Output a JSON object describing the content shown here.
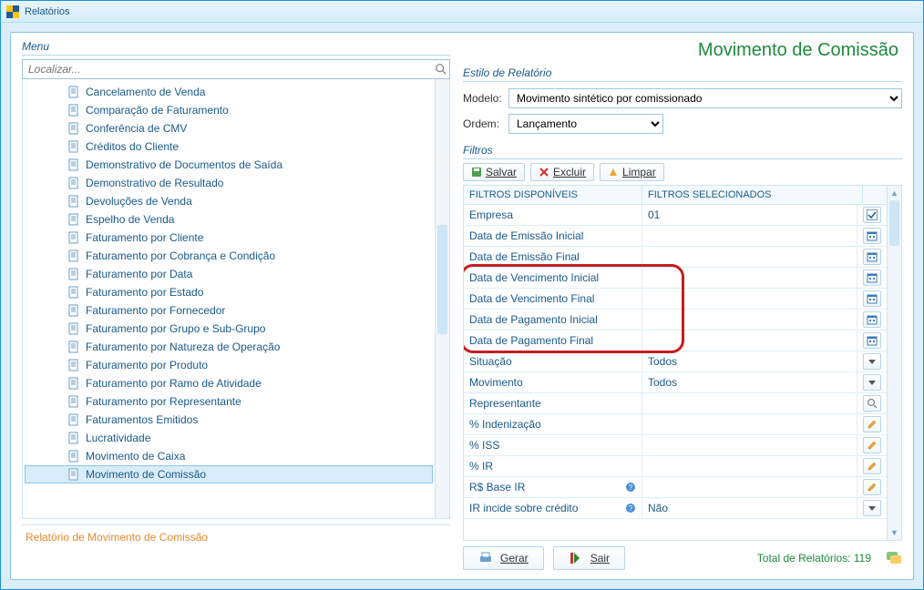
{
  "window": {
    "title": "Relatórios"
  },
  "menu": {
    "label": "Menu",
    "search_placeholder": "Localizar...",
    "items": [
      {
        "label": "Cancelamento de Venda"
      },
      {
        "label": "Comparação de Faturamento"
      },
      {
        "label": "Conferência de CMV"
      },
      {
        "label": "Créditos do Cliente"
      },
      {
        "label": "Demonstrativo de Documentos de Saída"
      },
      {
        "label": "Demonstrativo de Resultado"
      },
      {
        "label": "Devoluções de Venda"
      },
      {
        "label": "Espelho de Venda"
      },
      {
        "label": "Faturamento por Cliente"
      },
      {
        "label": "Faturamento por Cobrança e Condição"
      },
      {
        "label": "Faturamento por Data"
      },
      {
        "label": "Faturamento por Estado"
      },
      {
        "label": "Faturamento por Fornecedor"
      },
      {
        "label": "Faturamento por Grupo e Sub-Grupo"
      },
      {
        "label": "Faturamento por Natureza de Operação"
      },
      {
        "label": "Faturamento por Produto"
      },
      {
        "label": "Faturamento por Ramo de Atividade"
      },
      {
        "label": "Faturamento por Representante"
      },
      {
        "label": "Faturamentos Emitidos"
      },
      {
        "label": "Lucratividade"
      },
      {
        "label": "Movimento de Caixa"
      },
      {
        "label": "Movimento de Comissão"
      }
    ],
    "selected": "Movimento de Comissão",
    "description": "Relatório de Movimento de Comissão"
  },
  "right": {
    "title": "Movimento de Comissão",
    "style_group": "Estilo de Relatório",
    "modelo_label": "Modelo:",
    "modelo_value": "Movimento sintético por comissionado",
    "ordem_label": "Ordem:",
    "ordem_value": "Lançamento",
    "filters_group": "Filtros",
    "toolbar": {
      "salvar": "Salvar",
      "excluir": "Excluir",
      "limpar": "Limpar"
    },
    "header": {
      "available": "FILTROS DISPONÍVEIS",
      "selected": "FILTROS SELECIONADOS"
    },
    "rows": [
      {
        "label": "Empresa",
        "value": "01",
        "control": "check-select"
      },
      {
        "label": "Data de Emissão Inicial",
        "value": "",
        "control": "calendar"
      },
      {
        "label": "Data de Emissão Final",
        "value": "",
        "control": "calendar"
      },
      {
        "label": "Data de Vencimento Inicial",
        "value": "",
        "control": "calendar"
      },
      {
        "label": "Data de Vencimento Final",
        "value": "",
        "control": "calendar"
      },
      {
        "label": "Data de Pagamento Inicial",
        "value": "",
        "control": "calendar"
      },
      {
        "label": "Data de Pagamento Final",
        "value": "",
        "control": "calendar"
      },
      {
        "label": "Situação",
        "value": "Todos",
        "control": "dropdown"
      },
      {
        "label": "Movimento",
        "value": "Todos",
        "control": "dropdown"
      },
      {
        "label": "Representante",
        "value": "",
        "control": "search"
      },
      {
        "label": "% Indenização",
        "value": "",
        "control": "edit"
      },
      {
        "label": "% ISS",
        "value": "",
        "control": "edit"
      },
      {
        "label": "% IR",
        "value": "",
        "control": "edit"
      },
      {
        "label": "R$ Base IR",
        "value": "",
        "control": "edit",
        "info": true
      },
      {
        "label": "IR incide sobre crédito",
        "value": "Não",
        "control": "dropdown",
        "info": true
      }
    ],
    "highlight_rows": [
      3,
      4,
      5,
      6
    ],
    "footer": {
      "gerar": "Gerar",
      "sair": "Sair",
      "total_label": "Total de Relatórios:",
      "total_value": "119"
    }
  }
}
